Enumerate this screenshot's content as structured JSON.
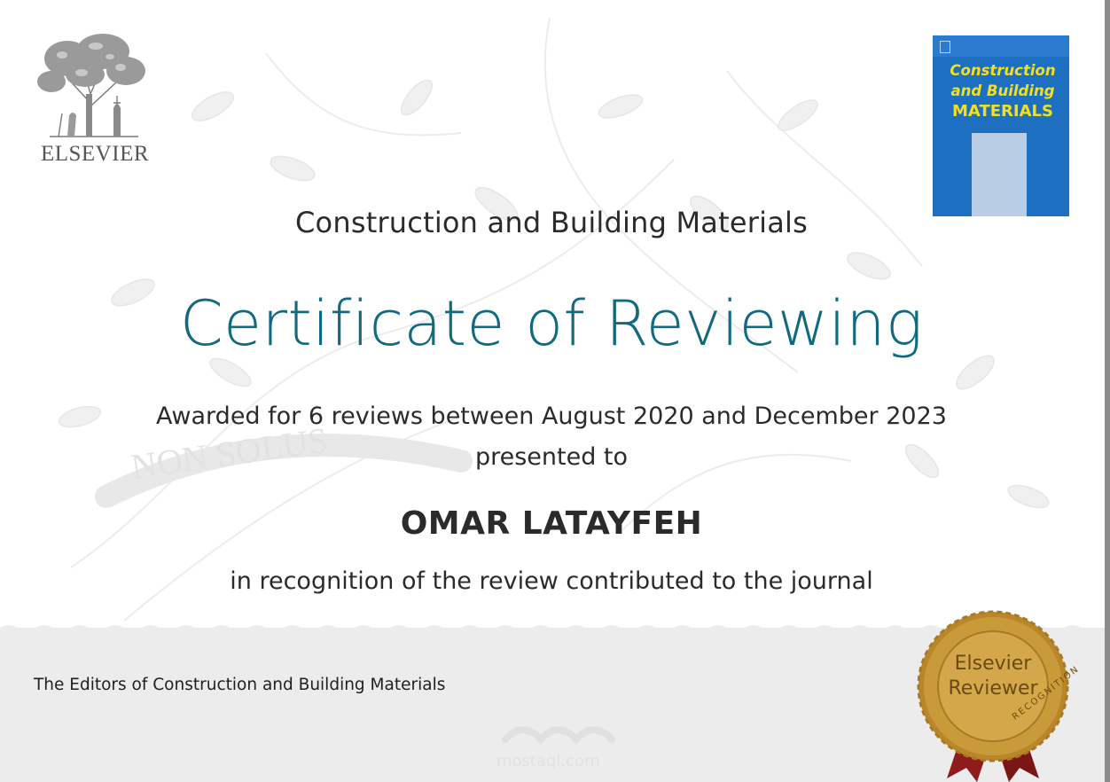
{
  "publisher": {
    "logo_icon": "elsevier-tree-icon",
    "name": "ELSEVIER"
  },
  "cover": {
    "title_line1": "Construction",
    "title_line2": "and Building",
    "title_line3": "MATERIALS",
    "background_color": "#1d6fc1",
    "title_color": "#f4e01a"
  },
  "certificate": {
    "journal": "Construction and Building Materials",
    "title": "Certificate of Reviewing",
    "awarded_line": "Awarded for 6 reviews between August 2020 and December 2023",
    "presented_line": "presented to",
    "recipient": "OMAR LATAYFEH",
    "recognition_line": "in recognition of the review contributed to the journal",
    "signature": "The Editors of Construction and Building Materials",
    "title_color": "#126a80"
  },
  "seal": {
    "line1": "Elsevier",
    "line2": "Reviewer",
    "ring_text": "RECOGNITION",
    "gold_color": "#c99a3a",
    "ribbon_color": "#8e1c1c"
  },
  "watermark": {
    "motto": "NON SOLUS",
    "brand": "mostaql.com"
  }
}
